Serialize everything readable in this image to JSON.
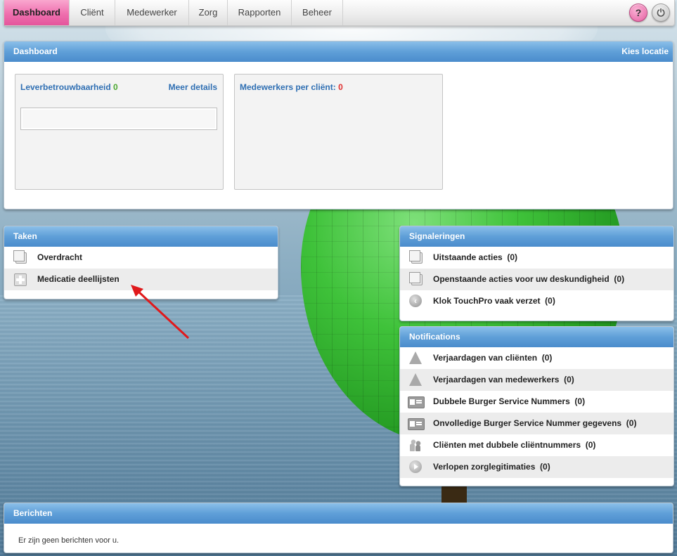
{
  "nav": {
    "tabs": [
      "Dashboard",
      "Cliënt",
      "Medewerker",
      "Zorg",
      "Rapporten",
      "Beheer"
    ],
    "active_tab": "Dashboard",
    "help_symbol": "?",
    "power_symbol": "⏻"
  },
  "dashboard": {
    "title": "Dashboard",
    "location_link": "Kies locatie",
    "widget_reliability": {
      "title": "Leverbetrouwbaarheid",
      "value": "0",
      "details_link": "Meer details"
    },
    "widget_staff": {
      "title": "Medewerkers per cliënt:",
      "value": "0"
    }
  },
  "taken": {
    "title": "Taken",
    "items": [
      {
        "label": "Overdracht",
        "icon": "document-icon"
      },
      {
        "label": "Medicatie deellijsten",
        "icon": "medical-cross-icon"
      }
    ]
  },
  "signaleringen": {
    "title": "Signaleringen",
    "items": [
      {
        "label": "Uitstaande acties",
        "count": "(0)",
        "icon": "document-icon"
      },
      {
        "label": "Openstaande acties voor uw deskundigheid",
        "count": "(0)",
        "icon": "document-icon"
      },
      {
        "label": "Klok TouchPro vaak verzet",
        "count": "(0)",
        "icon": "clock-icon"
      }
    ]
  },
  "notifications": {
    "title": "Notifications",
    "items": [
      {
        "label": "Verjaardagen van cliënten",
        "count": "(0)",
        "icon": "party-hat-icon"
      },
      {
        "label": "Verjaardagen van medewerkers",
        "count": "(0)",
        "icon": "party-hat-icon"
      },
      {
        "label": "Dubbele Burger Service Nummers",
        "count": "(0)",
        "icon": "id-card-icon"
      },
      {
        "label": "Onvolledige Burger Service Nummer gegevens",
        "count": "(0)",
        "icon": "id-card-icon"
      },
      {
        "label": "Cliënten met dubbele cliëntnummers",
        "count": "(0)",
        "icon": "people-icon"
      },
      {
        "label": "Verlopen zorglegitimaties",
        "count": "(0)",
        "icon": "play-icon"
      }
    ]
  },
  "berichten": {
    "title": "Berichten",
    "empty_text": "Er zijn geen berichten voor u."
  },
  "colors": {
    "nav_active": "#ef6fae",
    "panel_header": "#5f9fd8",
    "link_blue": "#2f6fb3",
    "value_green": "#4ca831",
    "value_red": "#e03030",
    "annotation_arrow": "#e0191b"
  }
}
